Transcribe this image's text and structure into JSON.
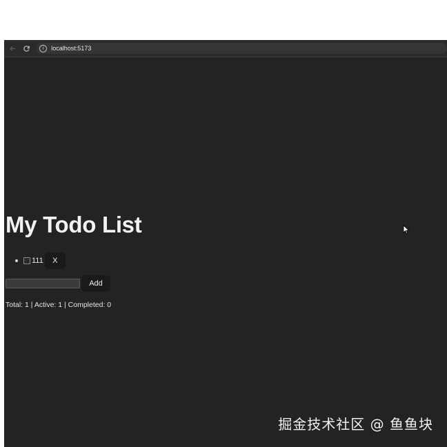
{
  "browser": {
    "url": "localhost:5173",
    "back_icon": "arrow-left-icon",
    "reload_icon": "reload-icon",
    "info_icon": "info-icon"
  },
  "app": {
    "title": "My Todo List",
    "todos": [
      {
        "text": "111",
        "completed": false,
        "delete_label": "X"
      }
    ],
    "input": {
      "value": "",
      "placeholder": ""
    },
    "add_label": "Add",
    "stats": "Total: 1 | Active: 1 | Completed: 0"
  },
  "watermark": "掘金技术社区 @ 鱼鱼块",
  "colors": {
    "page_background": "#232323",
    "button_background": "#1a1a1a",
    "text": "#f2f2f2"
  }
}
